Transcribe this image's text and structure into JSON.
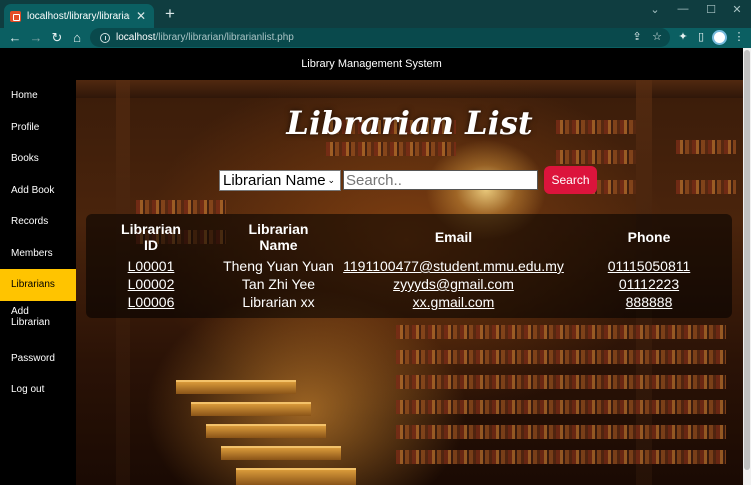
{
  "browser": {
    "tab_title": "localhost/library/librarian/libraria",
    "url_host": "localhost",
    "url_path": "/library/librarian/librarianlist.php"
  },
  "site": {
    "header_title": "Library Management System"
  },
  "sidebar": {
    "items": [
      {
        "label": "Home"
      },
      {
        "label": "Profile"
      },
      {
        "label": "Books"
      },
      {
        "label": "Add Book"
      },
      {
        "label": "Records"
      },
      {
        "label": "Members"
      },
      {
        "label": "Librarians",
        "active": true
      },
      {
        "label_line1": "Add",
        "label_line2": "Librarian"
      },
      {
        "label": "Password"
      },
      {
        "label": "Log out"
      }
    ]
  },
  "main": {
    "title": "Librarian List",
    "search": {
      "filter_selected": "Librarian Name",
      "placeholder": "Search..",
      "button_label": "Search"
    },
    "table": {
      "headers": {
        "id_line1": "Librarian",
        "id_line2": "ID",
        "name_line1": "Librarian",
        "name_line2": "Name",
        "email": "Email",
        "phone": "Phone"
      },
      "rows": [
        {
          "id": "L00001",
          "name": "Theng Yuan Yuan",
          "email": "1191100477@student.mmu.edu.my",
          "phone": "01115050811"
        },
        {
          "id": "L00002",
          "name": "Tan Zhi Yee",
          "email": "zyyyds@gmail.com",
          "phone": "01112223"
        },
        {
          "id": "L00006",
          "name": "Librarian xx",
          "email": "xx.gmail.com",
          "phone": "888888"
        }
      ]
    }
  },
  "colors": {
    "active_nav": "#ffc400",
    "search_button": "#dc143c",
    "browser_chrome": "#0b5f62"
  }
}
